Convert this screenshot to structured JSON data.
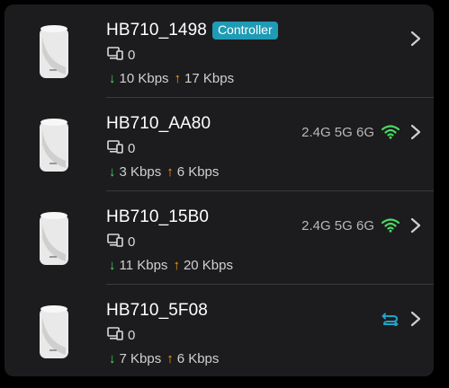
{
  "devices": [
    {
      "name": "HB710_1498",
      "badge": "Controller",
      "clients": "0",
      "down": "10 Kbps",
      "up": "17 Kbps",
      "bands": "",
      "connection_icon": "none"
    },
    {
      "name": "HB710_AA80",
      "badge": "",
      "clients": "0",
      "down": "3 Kbps",
      "up": "6 Kbps",
      "bands": "2.4G 5G 6G",
      "connection_icon": "wifi-icon"
    },
    {
      "name": "HB710_15B0",
      "badge": "",
      "clients": "0",
      "down": "11 Kbps",
      "up": "20 Kbps",
      "bands": "2.4G 5G 6G",
      "connection_icon": "wifi-icon"
    },
    {
      "name": "HB710_5F08",
      "badge": "",
      "clients": "0",
      "down": "7 Kbps",
      "up": "6 Kbps",
      "bands": "",
      "connection_icon": "ethernet-backhaul-icon"
    }
  ],
  "colors": {
    "card_bg": "#1c1c1e",
    "badge_bg": "#1f9bb5",
    "download_arrow": "#4cd964",
    "upload_arrow": "#ff9f0a",
    "wifi_green": "#4cd964",
    "mesh_teal": "#1fa3c4"
  }
}
